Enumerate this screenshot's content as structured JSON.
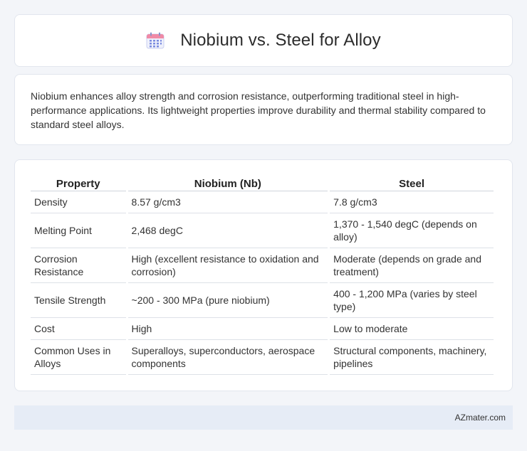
{
  "header": {
    "icon": "calendar-icon",
    "title": "Niobium vs. Steel for Alloy"
  },
  "intro": {
    "text": "Niobium enhances alloy strength and corrosion resistance, outperforming traditional steel in high-performance applications. Its lightweight properties improve durability and thermal stability compared to standard steel alloys."
  },
  "table": {
    "headers": [
      "Property",
      "Niobium (Nb)",
      "Steel"
    ],
    "rows": [
      [
        "Density",
        "8.57 g/cm3",
        "7.8 g/cm3"
      ],
      [
        "Melting Point",
        "2,468 degC",
        "1,370 - 1,540 degC (depends on alloy)"
      ],
      [
        "Corrosion Resistance",
        "High (excellent resistance to oxidation and corrosion)",
        "Moderate (depends on grade and treatment)"
      ],
      [
        "Tensile Strength",
        "~200 - 300 MPa (pure niobium)",
        "400 - 1,200 MPa (varies by steel type)"
      ],
      [
        "Cost",
        "High",
        "Low to moderate"
      ],
      [
        "Common Uses in Alloys",
        "Superalloys, superconductors, aerospace components",
        "Structural components, machinery, pipelines"
      ]
    ]
  },
  "footer": {
    "brand": "AZmater.com"
  },
  "colors": {
    "background": "#f3f5f9",
    "card": "#ffffff",
    "footer_bar": "#e6ecf6",
    "icon_accent": "#7b8ce0"
  }
}
